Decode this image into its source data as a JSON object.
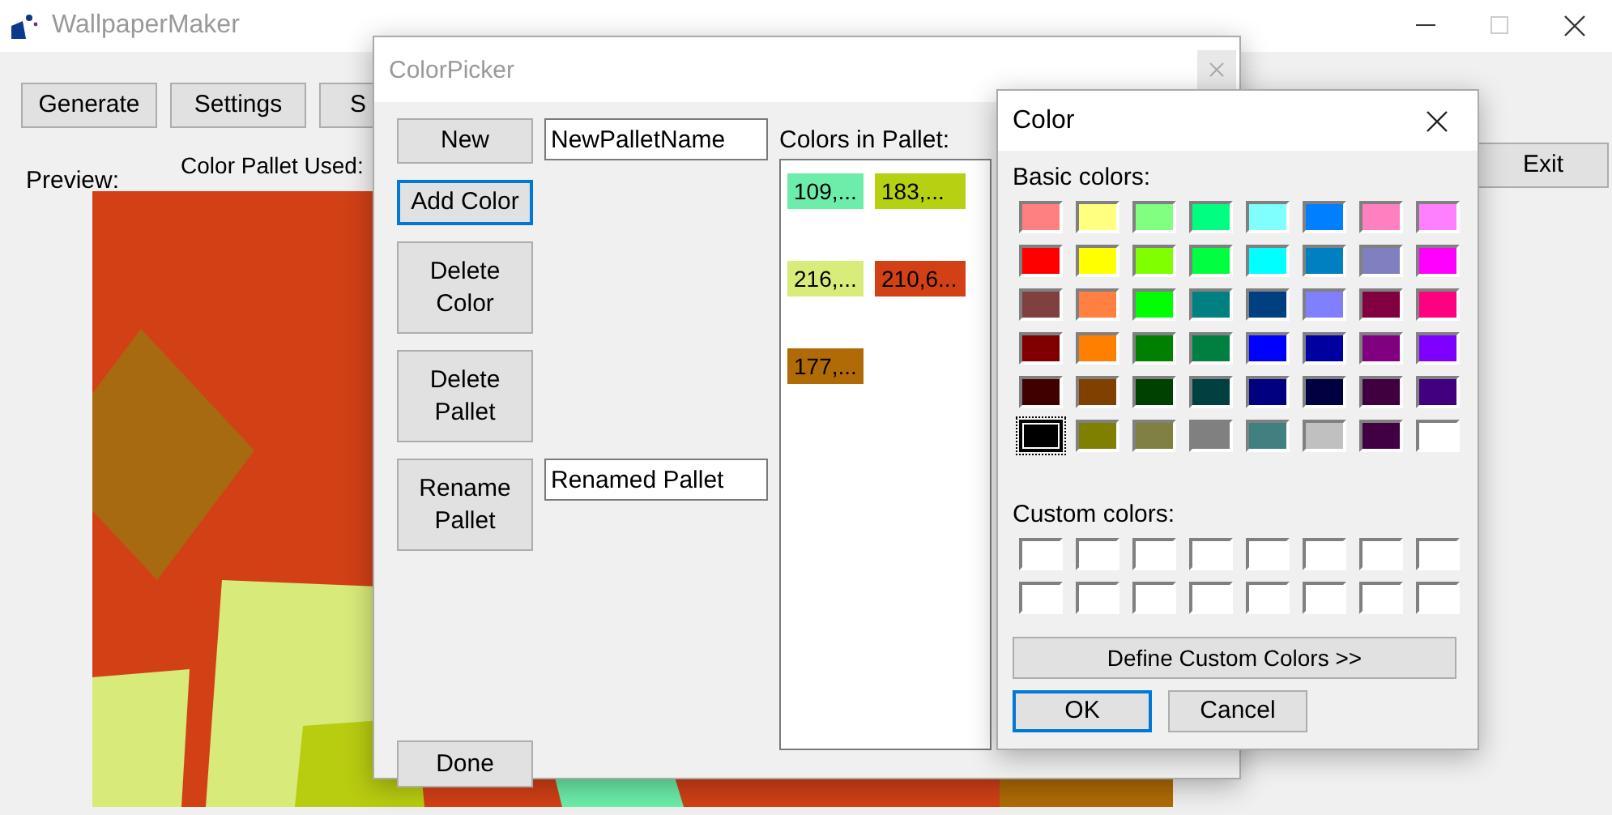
{
  "main_window": {
    "title": "WallpaperMaker",
    "buttons": [
      "Generate",
      "Settings",
      "S"
    ],
    "preview_label": "Preview:",
    "pallet_label": "Color Pallet Used:",
    "exit_button": "Exit"
  },
  "color_picker": {
    "title": "ColorPicker",
    "new_button": "New",
    "new_name": "NewPalletName",
    "add_color_button": {
      "label": "Add Color",
      "focused": true
    },
    "delete_color_button": "Delete Color",
    "delete_pallet_button": "Delete Pallet",
    "rename_button": "Rename Pallet",
    "rename_name": "Renamed Pallet",
    "done_button": "Done",
    "colors_label": "Colors in Pallet:",
    "colors": [
      {
        "label": "109,...",
        "color": "#6ceeaa"
      },
      {
        "label": "183,...",
        "color": "#b7d011"
      },
      {
        "label": "216,...",
        "color": "#d8ec7a"
      },
      {
        "label": "210,6...",
        "color": "#d24016"
      },
      {
        "label": "177,...",
        "color": "#b06b06"
      }
    ]
  },
  "color_dialog": {
    "title": "Color",
    "basic_label": "Basic colors:",
    "basic_colors": [
      {
        "color": "#ff8080",
        "selected": false
      },
      {
        "color": "#ffff80",
        "selected": false
      },
      {
        "color": "#80ff80",
        "selected": false
      },
      {
        "color": "#00ff80",
        "selected": false
      },
      {
        "color": "#80ffff",
        "selected": false
      },
      {
        "color": "#0080ff",
        "selected": false
      },
      {
        "color": "#ff80c0",
        "selected": false
      },
      {
        "color": "#ff80ff",
        "selected": false
      },
      {
        "color": "#ff0000",
        "selected": false
      },
      {
        "color": "#ffff00",
        "selected": false
      },
      {
        "color": "#80ff00",
        "selected": false
      },
      {
        "color": "#00ff40",
        "selected": false
      },
      {
        "color": "#00ffff",
        "selected": false
      },
      {
        "color": "#0080c0",
        "selected": false
      },
      {
        "color": "#8080c0",
        "selected": false
      },
      {
        "color": "#ff00ff",
        "selected": false
      },
      {
        "color": "#804040",
        "selected": false
      },
      {
        "color": "#ff8040",
        "selected": false
      },
      {
        "color": "#00ff00",
        "selected": false
      },
      {
        "color": "#008080",
        "selected": false
      },
      {
        "color": "#004080",
        "selected": false
      },
      {
        "color": "#8080ff",
        "selected": false
      },
      {
        "color": "#800040",
        "selected": false
      },
      {
        "color": "#ff0080",
        "selected": false
      },
      {
        "color": "#800000",
        "selected": false
      },
      {
        "color": "#ff8000",
        "selected": false
      },
      {
        "color": "#008000",
        "selected": false
      },
      {
        "color": "#008040",
        "selected": false
      },
      {
        "color": "#0000ff",
        "selected": false
      },
      {
        "color": "#0000a0",
        "selected": false
      },
      {
        "color": "#800080",
        "selected": false
      },
      {
        "color": "#8000ff",
        "selected": false
      },
      {
        "color": "#400000",
        "selected": false
      },
      {
        "color": "#804000",
        "selected": false
      },
      {
        "color": "#004000",
        "selected": false
      },
      {
        "color": "#004040",
        "selected": false
      },
      {
        "color": "#000080",
        "selected": false
      },
      {
        "color": "#000040",
        "selected": false
      },
      {
        "color": "#400040",
        "selected": false
      },
      {
        "color": "#400080",
        "selected": false
      },
      {
        "color": "#000000",
        "selected": true
      },
      {
        "color": "#808000",
        "selected": false
      },
      {
        "color": "#808040",
        "selected": false
      },
      {
        "color": "#808080",
        "selected": false
      },
      {
        "color": "#408080",
        "selected": false
      },
      {
        "color": "#c0c0c0",
        "selected": false
      },
      {
        "color": "#400041",
        "selected": false
      },
      {
        "color": "#ffffff",
        "selected": false
      }
    ],
    "custom_label": "Custom colors:",
    "custom_colors": [
      {
        "color": "#ffffff"
      },
      {
        "color": "#ffffff"
      },
      {
        "color": "#ffffff"
      },
      {
        "color": "#ffffff"
      },
      {
        "color": "#ffffff"
      },
      {
        "color": "#ffffff"
      },
      {
        "color": "#ffffff"
      },
      {
        "color": "#ffffff"
      },
      {
        "color": "#ffffff"
      },
      {
        "color": "#ffffff"
      },
      {
        "color": "#ffffff"
      },
      {
        "color": "#ffffff"
      },
      {
        "color": "#ffffff"
      },
      {
        "color": "#ffffff"
      },
      {
        "color": "#ffffff"
      },
      {
        "color": "#ffffff"
      }
    ],
    "define_button": "Define Custom Colors >>",
    "ok_button": {
      "label": "OK",
      "focused": true
    },
    "cancel_button": "Cancel"
  }
}
